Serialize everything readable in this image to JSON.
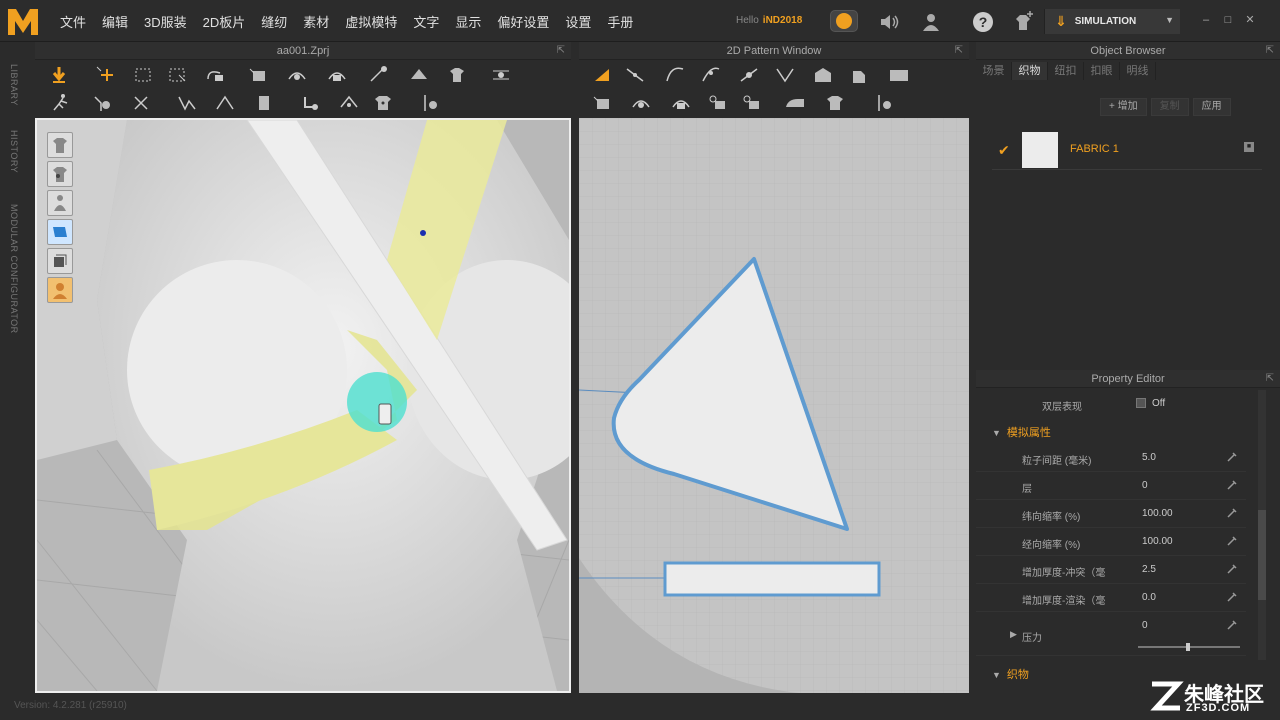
{
  "menu": [
    "文件",
    "编辑",
    "3D服装",
    "2D板片",
    "缝纫",
    "素材",
    "虚拟模特",
    "文字",
    "显示",
    "偏好设置",
    "设置",
    "手册"
  ],
  "user": {
    "hello": "Hello",
    "name": "iND2018"
  },
  "simulation_label": "SIMULATION",
  "sidebar": [
    "LIBRARY",
    "HISTORY",
    "MODULAR CONFIGURATOR"
  ],
  "view3d": {
    "title": "aa001.Zprj"
  },
  "view2d": {
    "title": "2D Pattern Window"
  },
  "object_browser": {
    "title": "Object Browser",
    "tabs": [
      "场景",
      "织物",
      "纽扣",
      "扣眼",
      "明线"
    ],
    "active_tab": 1,
    "buttons": {
      "add": "+ 增加",
      "copy": "复制",
      "apply": "应用"
    },
    "fabric_name": "FABRIC 1"
  },
  "property_editor": {
    "title": "Property Editor",
    "double_layer": {
      "label": "双层表现",
      "value": "Off"
    },
    "section_sim": "模拟属性",
    "rows": [
      {
        "k": "粒子间距 (毫米)",
        "v": "5.0"
      },
      {
        "k": "层",
        "v": "0"
      },
      {
        "k": "纬向缩率 (%)",
        "v": "100.00"
      },
      {
        "k": "经向缩率 (%)",
        "v": "100.00"
      },
      {
        "k": "增加厚度-冲突（毫",
        "v": "2.5"
      },
      {
        "k": "增加厚度-渲染（毫",
        "v": "0.0"
      }
    ],
    "pressure": {
      "label": "压力",
      "value": "0"
    },
    "section_fabric": "织物"
  },
  "version": "Version: 4.2.281 (r25910)",
  "watermark": {
    "cn": "朱峰社区",
    "url": "ZF3D.COM"
  }
}
